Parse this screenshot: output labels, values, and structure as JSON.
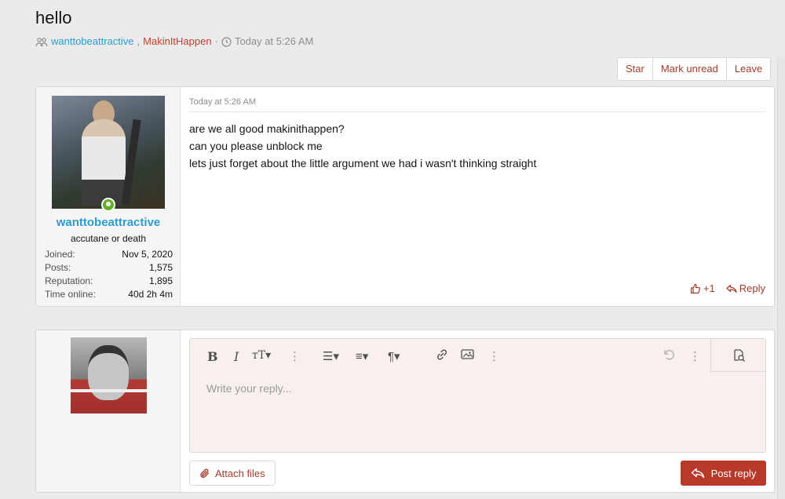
{
  "thread": {
    "title": "hello",
    "participant_1": "wanttobeattractive",
    "separator": ",",
    "participant_2": "MakinItHappen",
    "dot": "·",
    "time": "Today at 5:26 AM"
  },
  "actions": {
    "star": "Star",
    "mark_unread": "Mark unread",
    "leave": "Leave"
  },
  "post": {
    "username": "wanttobeattractive",
    "user_title": "accutane or death",
    "stats": [
      {
        "label": "Joined:",
        "value": "Nov 5, 2020"
      },
      {
        "label": "Posts:",
        "value": "1,575"
      },
      {
        "label": "Reputation:",
        "value": "1,895"
      },
      {
        "label": "Time online:",
        "value": "40d 2h 4m"
      }
    ],
    "date": "Today at 5:26 AM",
    "lines": [
      "are we all good makinithappen?",
      "can you please unblock me",
      "lets just forget about the little argument we had i wasn't thinking straight"
    ],
    "like_label": "+1",
    "reply_label": "Reply"
  },
  "editor": {
    "placeholder": "Write your reply...",
    "attach_label": "Attach files",
    "post_label": "Post reply"
  },
  "colors": {
    "link_blue": "#2b9ccd",
    "link_red": "#c33d2b",
    "action_red": "#a43b2b",
    "button_red": "#b8392a",
    "online_green": "#63b028"
  }
}
